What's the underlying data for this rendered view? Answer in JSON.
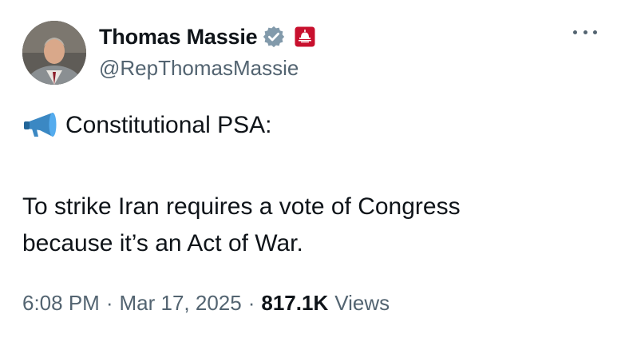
{
  "author": {
    "display_name": "Thomas Massie",
    "handle": "@RepThomasMassie"
  },
  "icons": {
    "verified": "verified-badge-icon",
    "affiliation": "capitol-dome-badge-icon",
    "more": "more-options-icon",
    "megaphone": "megaphone-emoji-icon"
  },
  "colors": {
    "verified_badge": "#829aab",
    "affiliation_badge": "#c8102e",
    "secondary_text": "#536471",
    "primary_text": "#0f1419"
  },
  "tweet": {
    "headline": "Constitutional PSA:",
    "body_line1": "To strike Iran requires a vote of Congress",
    "body_line2": "because it’s an Act of War."
  },
  "meta": {
    "time": "6:08 PM",
    "separator": "·",
    "date": "Mar 17, 2025",
    "views_count": "817.1K",
    "views_label": "Views"
  }
}
